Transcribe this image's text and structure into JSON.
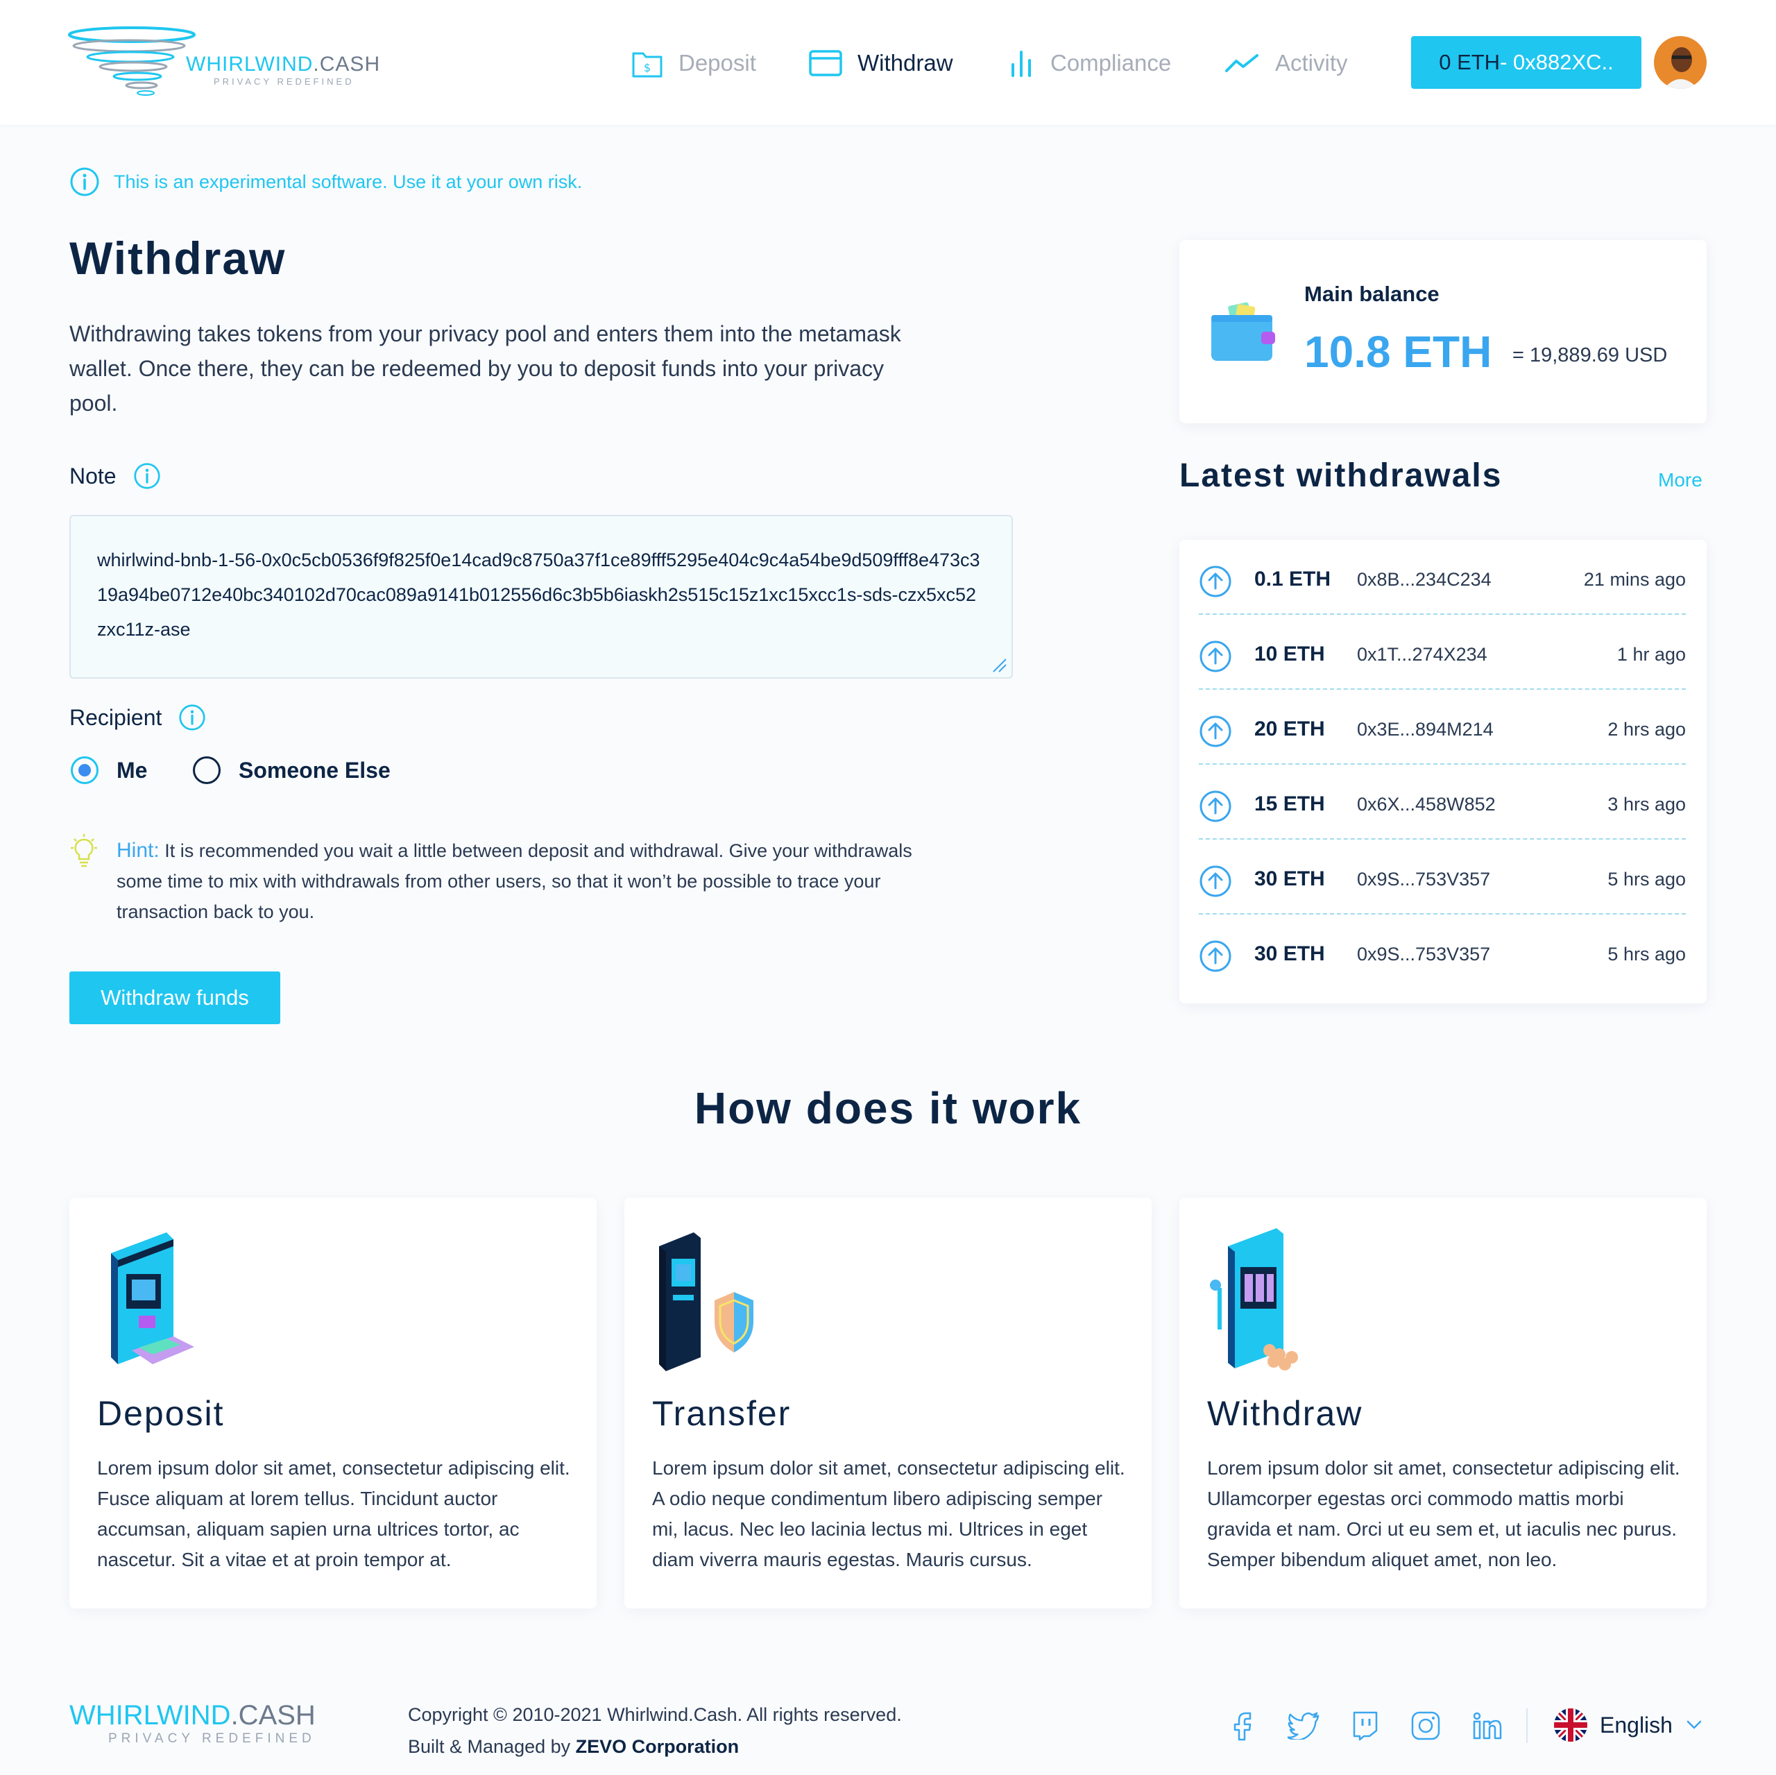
{
  "brand": {
    "name_part1": "WHIRLWIND",
    "name_part2": ".CASH",
    "tagline": "PRIVACY REDEFINED"
  },
  "nav": {
    "items": [
      {
        "label": "Deposit",
        "icon": "wallet-dollar-icon",
        "active": false
      },
      {
        "label": "Withdraw",
        "icon": "card-icon",
        "active": true
      },
      {
        "label": "Compliance",
        "icon": "bar-chart-icon",
        "active": false
      },
      {
        "label": "Activity",
        "icon": "trend-line-icon",
        "active": false
      }
    ],
    "wallet_eth": "0 ETH",
    "wallet_addr": " - 0x882XC..",
    "avatar_icon": "user-avatar"
  },
  "notice": "This is an experimental software. Use it at your own risk.",
  "withdraw": {
    "title": "Withdraw",
    "description": "Withdrawing takes tokens from your privacy pool and enters them into the metamask wallet. Once there, they can be redeemed by you to deposit funds into your privacy pool.",
    "note_label": "Note",
    "note_value": "whirlwind-bnb-1-56-0x0c5cb0536f9f825f0e14cad9c8750a37f1ce89fff5295e404c9c4a54be9d509fff8e473c319a94be0712e40bc340102d70cac089a9141b012556d6c3b5b6iaskh2s515c15z1xc15xcc1s-sds-czx5xc52zxc11z-ase",
    "recipient_label": "Recipient",
    "recipient_options": [
      {
        "label": "Me",
        "selected": true
      },
      {
        "label": "Someone Else",
        "selected": false
      }
    ],
    "hint_label": "Hint:",
    "hint_text": " It is recommended you wait a little between deposit and withdrawal. Give your withdrawals some time to mix with withdrawals from other users, so that it won’t be possible to trace your transaction back to you.",
    "button_label": "Withdraw funds"
  },
  "balance": {
    "label": "Main balance",
    "amount": "10.8 ETH",
    "usd": "= 19,889.69 USD"
  },
  "latest": {
    "title": "Latest withdrawals",
    "more_label": "More",
    "rows": [
      {
        "amount": "0.1 ETH",
        "address": "0x8B...234C234",
        "time": "21 mins ago"
      },
      {
        "amount": "10 ETH",
        "address": "0x1T...274X234",
        "time": "1 hr ago"
      },
      {
        "amount": "20 ETH",
        "address": "0x3E...894M214",
        "time": "2 hrs ago"
      },
      {
        "amount": "15 ETH",
        "address": "0x6X...458W852",
        "time": "3 hrs ago"
      },
      {
        "amount": "30 ETH",
        "address": "0x9S...753V357",
        "time": "5 hrs ago"
      },
      {
        "amount": "30 ETH",
        "address": "0x9S...753V357",
        "time": "5 hrs ago"
      }
    ]
  },
  "how": {
    "title": "How does it work",
    "cards": [
      {
        "title": "Deposit",
        "text": "Lorem ipsum dolor sit amet, consectetur adipiscing elit. Fusce aliquam at lorem tellus. Tincidunt auctor accumsan, aliquam sapien urna ultrices tortor, ac nascetur. Sit a vitae et at proin tempor at."
      },
      {
        "title": "Transfer",
        "text": "Lorem ipsum dolor sit amet, consectetur adipiscing elit. A odio neque condimentum libero adipiscing semper mi, lacus. Nec leo lacinia lectus mi. Ultrices in eget diam viverra mauris egestas. Mauris cursus."
      },
      {
        "title": "Withdraw",
        "text": "Lorem ipsum dolor sit amet, consectetur adipiscing elit. Ullamcorper egestas orci commodo mattis morbi gravida et nam. Orci ut eu sem et, ut iaculis nec purus. Semper bibendum aliquet amet, non leo."
      }
    ]
  },
  "footer": {
    "copyright": "Copyright © 2010-2021 Whirlwind.Cash. All rights reserved.",
    "built_by": "Built & Managed by ",
    "corp": "ZEVO Corporation",
    "socials": [
      "facebook-icon",
      "twitter-icon",
      "twitch-icon",
      "instagram-icon",
      "linkedin-icon"
    ],
    "language": "English"
  },
  "colors": {
    "accent": "#1fc6f0",
    "primary_text": "#0d2545",
    "link_blue": "#3aa6ef"
  }
}
